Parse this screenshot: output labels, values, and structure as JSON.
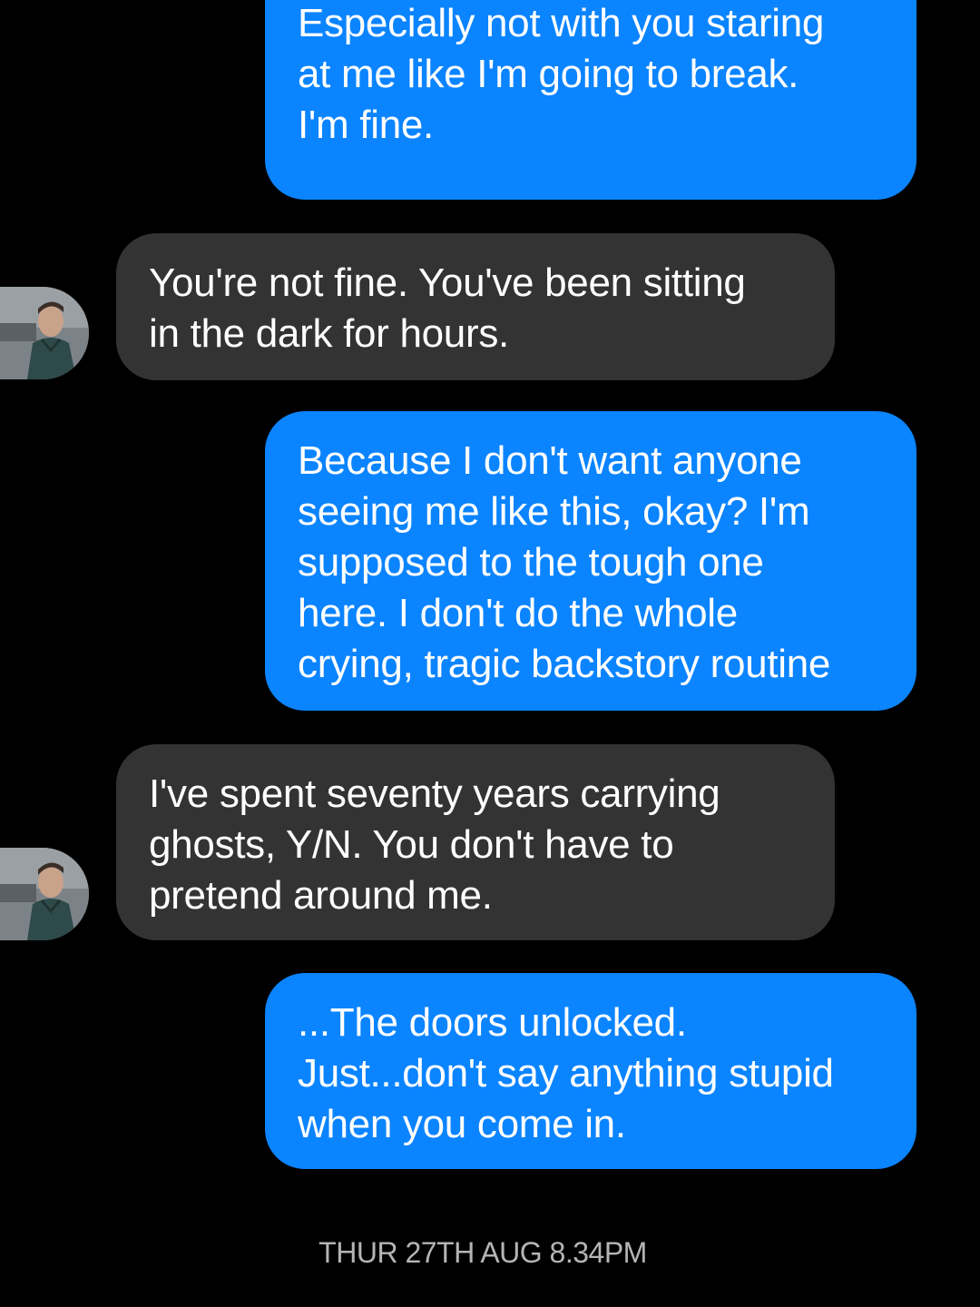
{
  "conversation": {
    "messages": [
      {
        "direction": "sent",
        "text": "I don't want to talk about it.\nEspecially not with you staring\nat me like I'm going to break.\nI'm fine."
      },
      {
        "direction": "received",
        "text": "You're not fine. You've been sitting\nin the dark for hours.",
        "avatar_icon": "contact-avatar-photo"
      },
      {
        "direction": "sent",
        "text": "Because I don't want anyone\nseeing me like this, okay? I'm\nsupposed to the tough one\nhere. I don't do the whole\ncrying, tragic backstory routine"
      },
      {
        "direction": "received",
        "text": "I've spent seventy years carrying\nghosts, Y/N. You don't have to\npretend around me.",
        "avatar_icon": "contact-avatar-photo"
      },
      {
        "direction": "sent",
        "text": "...The doors unlocked.\nJust...don't say anything stupid\nwhen you come in."
      }
    ],
    "timestamp": "THUR 27TH AUG 8.34PM"
  },
  "colors": {
    "background": "#000000",
    "sent_bubble": "#0b84ff",
    "received_bubble": "#333333",
    "text": "#ffffff",
    "timestamp": "#b5b5b5"
  }
}
